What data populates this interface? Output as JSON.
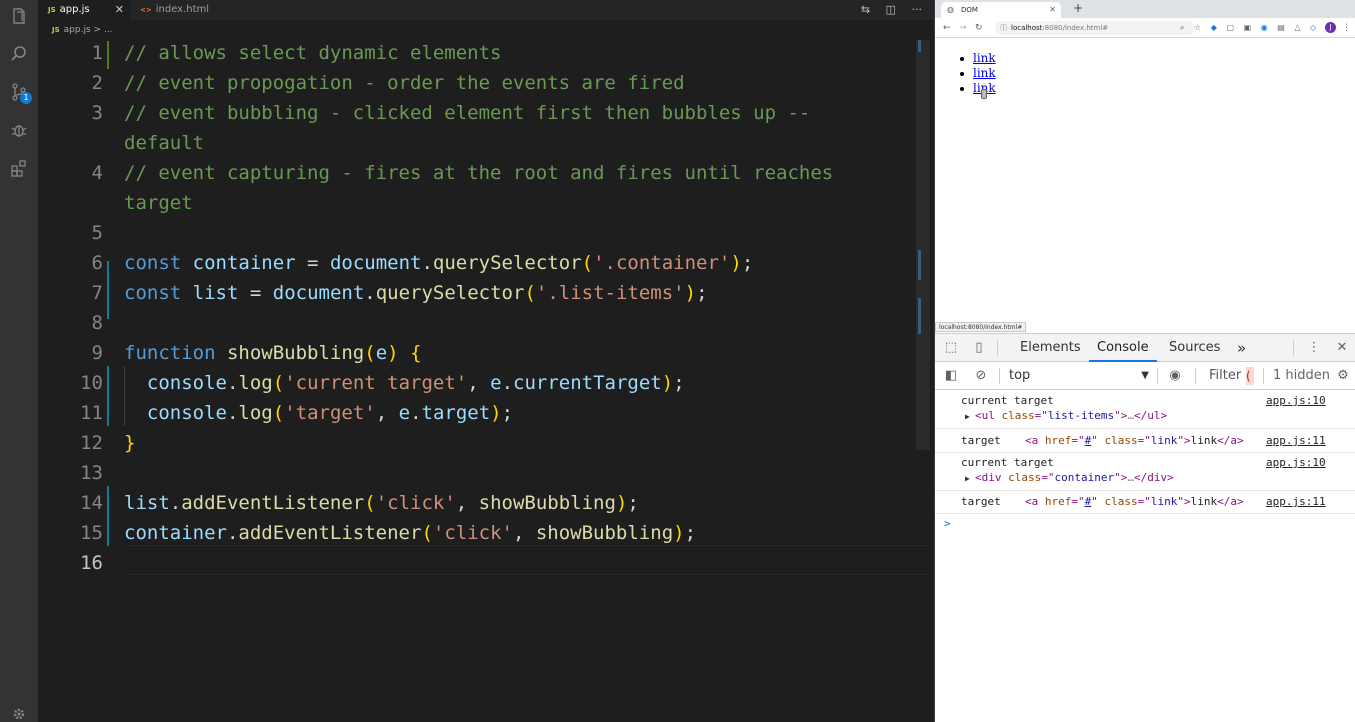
{
  "editor": {
    "tabs": [
      {
        "icon": "JS",
        "label": "app.js",
        "active": true
      },
      {
        "icon": "<>",
        "label": "index.html",
        "active": false
      }
    ],
    "breadcrumb": {
      "icon": "JS",
      "file": "app.js",
      "sep": ">",
      "more": "..."
    },
    "activity_badge": "1",
    "lines": [
      {
        "n": "1",
        "tokens": [
          [
            "cm",
            "// allows select dynamic elements"
          ]
        ]
      },
      {
        "n": "2",
        "tokens": [
          [
            "cm",
            "// event propogation - order the events are fired"
          ]
        ]
      },
      {
        "n": "3",
        "tokens": [
          [
            "cm",
            "// event bubbling - clicked element first then bubbles up --"
          ]
        ]
      },
      {
        "n": "",
        "tokens": [
          [
            "cm",
            "default"
          ]
        ]
      },
      {
        "n": "4",
        "tokens": [
          [
            "cm",
            "// event capturing - fires at the root and fires until reaches"
          ]
        ]
      },
      {
        "n": "",
        "tokens": [
          [
            "cm",
            "target"
          ]
        ]
      },
      {
        "n": "5",
        "tokens": []
      },
      {
        "n": "6",
        "tokens": [
          [
            "kw",
            "const"
          ],
          [
            "pu",
            " "
          ],
          [
            "vr",
            "container"
          ],
          [
            "pu",
            " = "
          ],
          [
            "vr",
            "document"
          ],
          [
            "pu",
            "."
          ],
          [
            "fn",
            "querySelector"
          ],
          [
            "br",
            "("
          ],
          [
            "st",
            "'.container'"
          ],
          [
            "br",
            ")"
          ],
          [
            "pu",
            ";"
          ]
        ]
      },
      {
        "n": "7",
        "tokens": [
          [
            "kw",
            "const"
          ],
          [
            "pu",
            " "
          ],
          [
            "vr",
            "list"
          ],
          [
            "pu",
            " = "
          ],
          [
            "vr",
            "document"
          ],
          [
            "pu",
            "."
          ],
          [
            "fn",
            "querySelector"
          ],
          [
            "br",
            "("
          ],
          [
            "st",
            "'.list-items'"
          ],
          [
            "br",
            ")"
          ],
          [
            "pu",
            ";"
          ]
        ]
      },
      {
        "n": "8",
        "tokens": []
      },
      {
        "n": "9",
        "tokens": [
          [
            "kw",
            "function"
          ],
          [
            "pu",
            " "
          ],
          [
            "fn",
            "showBubbling"
          ],
          [
            "br",
            "("
          ],
          [
            "vr",
            "e"
          ],
          [
            "br",
            ")"
          ],
          [
            "pu",
            " "
          ],
          [
            "br",
            "{"
          ]
        ]
      },
      {
        "n": "10",
        "tokens": [
          [
            "pu",
            "  "
          ],
          [
            "vr",
            "console"
          ],
          [
            "pu",
            "."
          ],
          [
            "fn",
            "log"
          ],
          [
            "br",
            "("
          ],
          [
            "st",
            "'current target'"
          ],
          [
            "pu",
            ", "
          ],
          [
            "vr",
            "e"
          ],
          [
            "pu",
            "."
          ],
          [
            "vr",
            "currentTarget"
          ],
          [
            "br",
            ")"
          ],
          [
            "pu",
            ";"
          ]
        ]
      },
      {
        "n": "11",
        "tokens": [
          [
            "pu",
            "  "
          ],
          [
            "vr",
            "console"
          ],
          [
            "pu",
            "."
          ],
          [
            "fn",
            "log"
          ],
          [
            "br",
            "("
          ],
          [
            "st",
            "'target'"
          ],
          [
            "pu",
            ", "
          ],
          [
            "vr",
            "e"
          ],
          [
            "pu",
            "."
          ],
          [
            "vr",
            "target"
          ],
          [
            "br",
            ")"
          ],
          [
            "pu",
            ";"
          ]
        ]
      },
      {
        "n": "12",
        "tokens": [
          [
            "br",
            "}"
          ]
        ]
      },
      {
        "n": "13",
        "tokens": []
      },
      {
        "n": "14",
        "tokens": [
          [
            "vr",
            "list"
          ],
          [
            "pu",
            "."
          ],
          [
            "fn",
            "addEventListener"
          ],
          [
            "br",
            "("
          ],
          [
            "st",
            "'click'"
          ],
          [
            "pu",
            ", "
          ],
          [
            "fn",
            "showBubbling"
          ],
          [
            "br",
            ")"
          ],
          [
            "pu",
            ";"
          ]
        ]
      },
      {
        "n": "15",
        "tokens": [
          [
            "vr",
            "container"
          ],
          [
            "pu",
            "."
          ],
          [
            "fn",
            "addEventListener"
          ],
          [
            "br",
            "("
          ],
          [
            "st",
            "'click'"
          ],
          [
            "pu",
            ", "
          ],
          [
            "fn",
            "showBubbling"
          ],
          [
            "br",
            ")"
          ],
          [
            "pu",
            ";"
          ]
        ]
      },
      {
        "n": "16",
        "tokens": []
      }
    ]
  },
  "browser": {
    "tab_title": "DOM",
    "new_tab": "+",
    "url_host": "localhost",
    "url_rest": ":8080/index.html#",
    "avatar_letter": "J",
    "page_links": [
      "link",
      "link",
      "link"
    ],
    "status_url": "localhost:8080/index.html#"
  },
  "devtools": {
    "tabs": [
      "Elements",
      "Console",
      "Sources"
    ],
    "more": "»",
    "context": "top",
    "filter_placeholder": "Filter",
    "hidden_count": "1 hidden",
    "messages": [
      {
        "text": "current target",
        "source": "app.js:10",
        "node": {
          "tag": "ul",
          "attr": "class",
          "value": "list-items",
          "collapsed": true
        }
      },
      {
        "text": "target",
        "source": "app.js:11",
        "node": {
          "tag": "a",
          "attr1": "href",
          "value1": "#",
          "attr2": "class",
          "value2": "link",
          "content": "link"
        }
      },
      {
        "text": "current target",
        "source": "app.js:10",
        "node": {
          "tag": "div",
          "attr": "class",
          "value": "container",
          "collapsed": true
        }
      },
      {
        "text": "target",
        "source": "app.js:11",
        "node": {
          "tag": "a",
          "attr1": "href",
          "value1": "#",
          "attr2": "class",
          "value2": "link",
          "content": "link"
        }
      }
    ],
    "prompt": ">"
  },
  "colors": {
    "comment": "#6a9955",
    "keyword": "#569cd6",
    "variable": "#9cdcfe",
    "function": "#dcdcaa",
    "string": "#ce9178",
    "link": "#0000ee",
    "devtools_accent": "#1a73e8"
  }
}
